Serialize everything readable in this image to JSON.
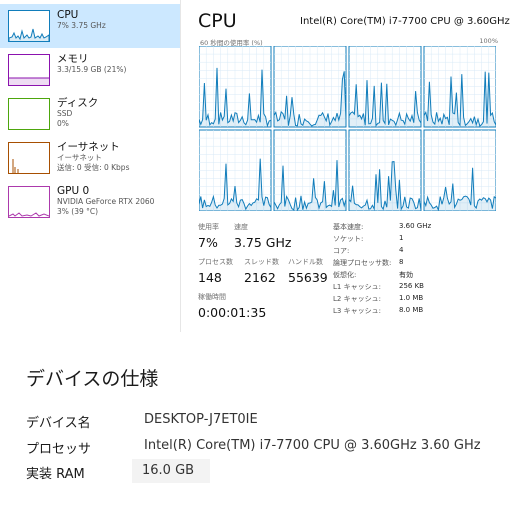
{
  "sidebar": {
    "items": [
      {
        "name": "CPU",
        "detail": "7%  3.75 GHz",
        "detail2": "",
        "color": "#117dbb",
        "active": true
      },
      {
        "name": "メモリ",
        "detail": "3.3/15.9 GB (21%)",
        "detail2": "",
        "color": "#8b12ae",
        "active": false
      },
      {
        "name": "ディスク",
        "detail": "SSD",
        "detail2": "0%",
        "color": "#4da60c",
        "active": false
      },
      {
        "name": "イーサネット",
        "detail": "イーサネット",
        "detail2": "送信: 0  受信: 0 Kbps",
        "color": "#a74f01",
        "active": false
      },
      {
        "name": "GPU 0",
        "detail": "NVIDIA GeForce RTX 2060",
        "detail2": "3% (39 °C)",
        "color": "#ac39ac",
        "active": false
      }
    ]
  },
  "cpu": {
    "title": "CPU",
    "model": "Intel(R) Core(TM) i7-7700 CPU @ 3.60GHz",
    "graph_label": "60 秒間の使用率 (%)",
    "graph_max": "100%",
    "graph_color": "#117dbb",
    "utilization_label": "使用率",
    "utilization": "7%",
    "speed_label": "速度",
    "speed": "3.75 GHz",
    "processes_label": "プロセス数",
    "processes": "148",
    "threads_label": "スレッド数",
    "threads": "2162",
    "handles_label": "ハンドル数",
    "handles": "55639",
    "uptime_label": "稼働時間",
    "uptime": "0:00:01:35",
    "specs": [
      {
        "key": "基本速度:",
        "value": "3.60 GHz"
      },
      {
        "key": "ソケット:",
        "value": "1"
      },
      {
        "key": "コア:",
        "value": "4"
      },
      {
        "key": "論理プロセッサ数:",
        "value": "8"
      },
      {
        "key": "仮想化:",
        "value": "有効"
      },
      {
        "key": "L1 キャッシュ:",
        "value": "256 KB"
      },
      {
        "key": "L2 キャッシュ:",
        "value": "1.0 MB"
      },
      {
        "key": "L3 キャッシュ:",
        "value": "8.0 MB"
      }
    ]
  },
  "device": {
    "title": "デバイスの仕様",
    "rows": [
      {
        "key": "デバイス名",
        "value": "DESKTOP-J7ET0IE"
      },
      {
        "key": "プロセッサ",
        "value": "Intel(R) Core(TM) i7-7700 CPU @ 3.60GHz   3.60 GHz"
      },
      {
        "key": "実装 RAM",
        "value": "16.0 GB"
      }
    ]
  }
}
